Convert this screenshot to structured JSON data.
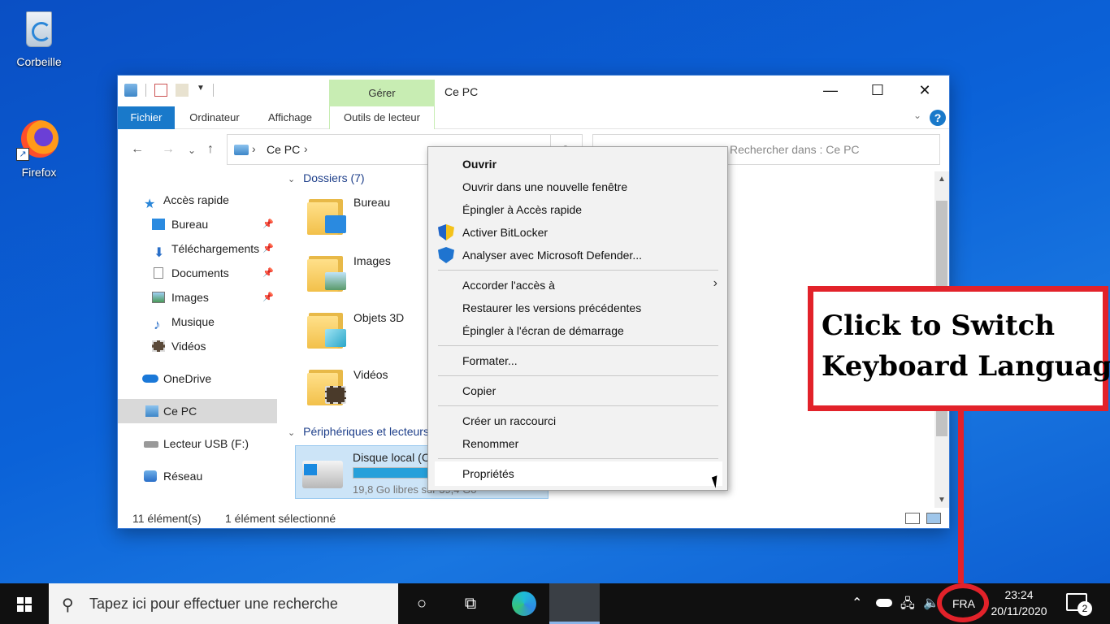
{
  "desktop": {
    "icons": [
      {
        "label": "Corbeille"
      },
      {
        "label": "Firefox"
      }
    ]
  },
  "window": {
    "title": "Ce PC",
    "context_tab": "Gérer",
    "tabs": [
      "Fichier",
      "Ordinateur",
      "Affichage",
      "Outils de lecteur"
    ],
    "address": "Ce PC",
    "search_placeholder": "Rechercher dans : Ce PC",
    "nav": {
      "quick_access": "Accès rapide",
      "items": [
        "Bureau",
        "Téléchargements",
        "Documents",
        "Images",
        "Musique",
        "Vidéos"
      ],
      "onedrive": "OneDrive",
      "this_pc": "Ce PC",
      "usb": "Lecteur USB (F:)",
      "network": "Réseau"
    },
    "groups": {
      "folders": "Dossiers (7)",
      "devices": "Périphériques et lecteurs"
    },
    "folders": [
      "Bureau",
      "Images",
      "Objets 3D",
      "Vidéos"
    ],
    "drive": {
      "name": "Disque local (C:)",
      "free": "19,8 Go libres sur 39,4 Go",
      "usage_percent": 50
    },
    "status": {
      "count": "11 élément(s)",
      "selected": "1 élément sélectionné"
    }
  },
  "context_menu": {
    "items": [
      "Ouvrir",
      "Ouvrir dans une nouvelle fenêtre",
      "Épingler à Accès rapide",
      "Activer BitLocker",
      "Analyser avec Microsoft Defender...",
      "Accorder l'accès à",
      "Restaurer les versions précédentes",
      "Épingler à l'écran de démarrage",
      "Formater...",
      "Copier",
      "Créer un raccourci",
      "Renommer",
      "Propriétés"
    ]
  },
  "callout": {
    "line1": "Click to Switch",
    "line2": "Keyboard Language"
  },
  "taskbar": {
    "search_placeholder": "Tapez ici pour effectuer une recherche",
    "language": "FRA",
    "time": "23:24",
    "date": "20/11/2020",
    "notifications": "2"
  }
}
